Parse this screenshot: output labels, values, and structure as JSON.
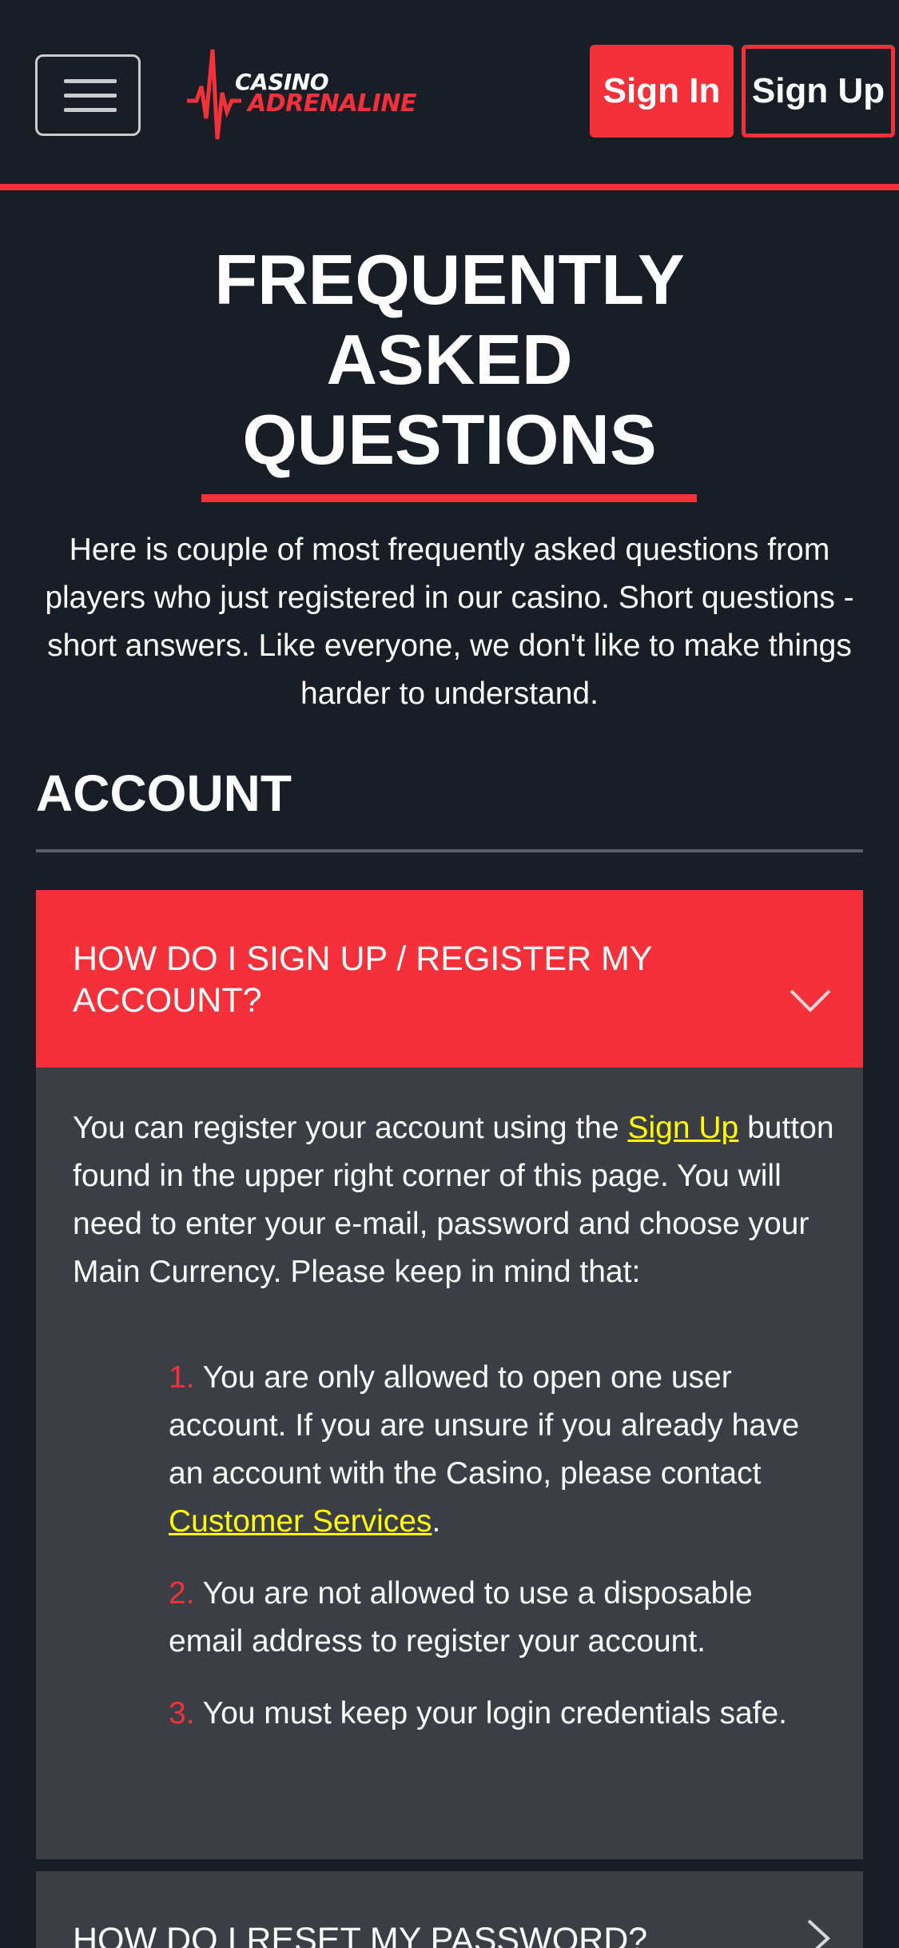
{
  "header": {
    "menu_icon": "hamburger-menu-icon",
    "logo": {
      "line1": "CASINO",
      "line2": "ADRENALINE"
    },
    "sign_in_label": "Sign In",
    "sign_up_label": "Sign Up"
  },
  "colors": {
    "background": "#191e26",
    "accent": "#f4313a",
    "panel": "#3b3f45",
    "link": "#ffff00"
  },
  "main": {
    "title_lines": [
      "FREQUENTLY",
      "ASKED",
      "QUESTIONS"
    ],
    "intro": "Here is couple of most frequently asked questions from players who just registered in our casino. Short questions - short answers. Like everyone, we don't like to make things harder to understand.",
    "section": {
      "heading": "ACCOUNT",
      "faqs": [
        {
          "question": "How do I sign up / register my account?",
          "expanded": true,
          "answer": {
            "before_link": "You can register your account using the ",
            "link": "Sign Up",
            "after_link": " button found in the upper right corner of this page. You will need to enter your e-mail, password and choose your Main Currency. Please keep in mind that:",
            "rules": [
              {
                "num": "1.",
                "text_before": " You are only allowed to open one user account. If you are unsure if you already have an account with the Casino, please contact ",
                "link": "Customer Services",
                "text_after": "."
              },
              {
                "num": "2.",
                "text_before": " You are not allowed to use a disposable email address to register your account.",
                "link": "",
                "text_after": ""
              },
              {
                "num": "3.",
                "text_before": " You must keep your login credentials safe.",
                "link": "",
                "text_after": ""
              }
            ]
          }
        },
        {
          "question": "How do I reset my password?",
          "expanded": false
        }
      ]
    }
  }
}
